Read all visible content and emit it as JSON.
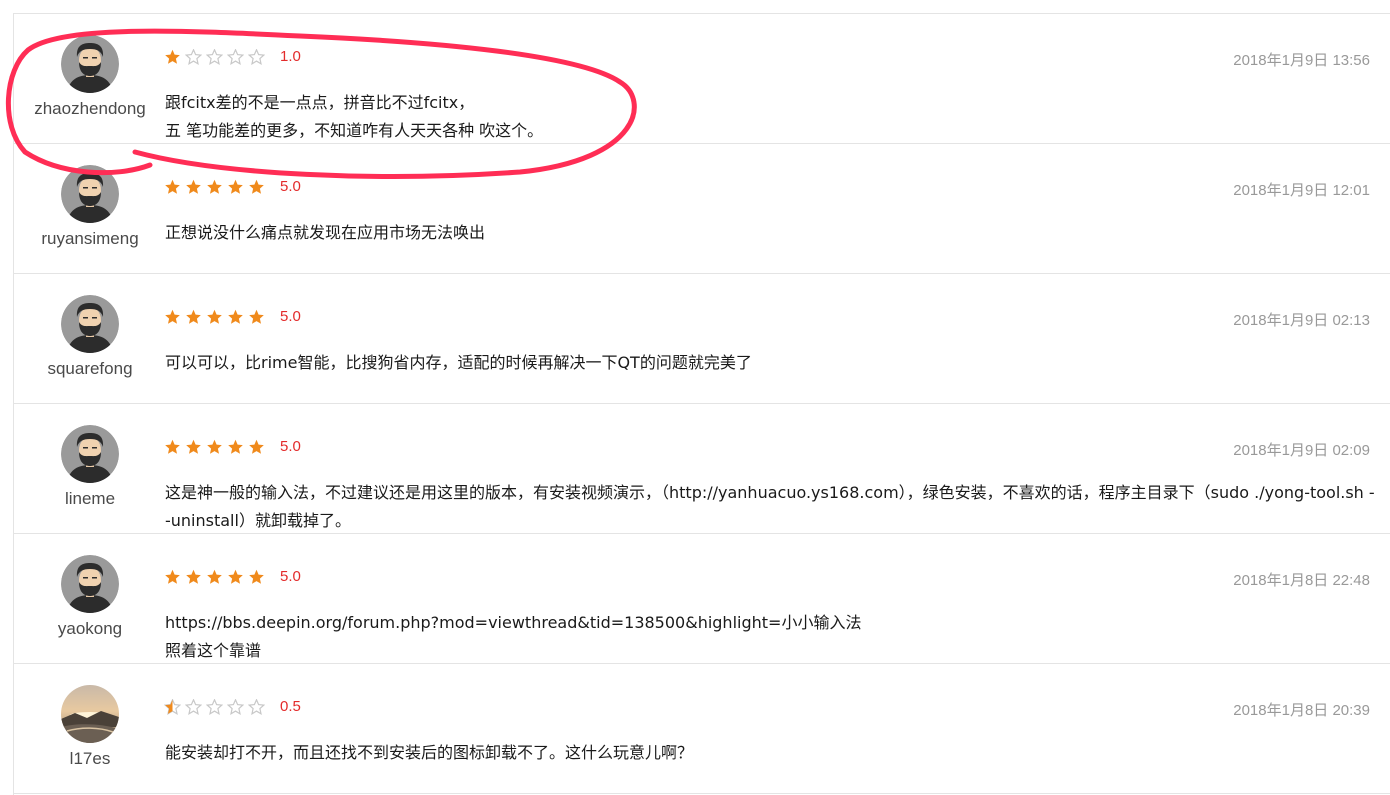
{
  "colors": {
    "star_filled": "#f08a1c",
    "star_empty": "#c8c8c8",
    "score": "#e32b2b",
    "date": "#999999",
    "annotation": "#ff2d55"
  },
  "reviews": [
    {
      "username": "zhaozhendong",
      "avatar": "bearded-man-avatar-icon",
      "rating": 1.0,
      "score_text": "1.0",
      "date": "2018年1月9日 13:56",
      "comment_lines": [
        "跟fcitx差的不是一点点，拼音比不过fcitx，",
        "五 笔功能差的更多，不知道咋有人天天各种 吹这个。"
      ]
    },
    {
      "username": "ruyansimeng",
      "avatar": "bearded-man-avatar-icon",
      "rating": 5.0,
      "score_text": "5.0",
      "date": "2018年1月9日 12:01",
      "comment_lines": [
        "正想说没什么痛点就发现在应用市场无法唤出"
      ]
    },
    {
      "username": "squarefong",
      "avatar": "bearded-man-avatar-icon",
      "rating": 5.0,
      "score_text": "5.0",
      "date": "2018年1月9日 02:13",
      "comment_lines": [
        "可以可以，比rime智能，比搜狗省内存，适配的时候再解决一下QT的问题就完美了"
      ]
    },
    {
      "username": "lineme",
      "avatar": "bearded-man-avatar-icon",
      "rating": 5.0,
      "score_text": "5.0",
      "date": "2018年1月9日 02:09",
      "comment_lines": [
        "这是神一般的输入法，不过建议还是用这里的版本，有安装视频演示，（http://yanhuacuo.ys168.com），绿色安装，不喜欢的话，程序主目录下（sudo ./yong-tool.sh --uninstall）就卸载掉了。"
      ]
    },
    {
      "username": "yaokong",
      "avatar": "bearded-man-avatar-icon",
      "rating": 5.0,
      "score_text": "5.0",
      "date": "2018年1月8日 22:48",
      "comment_lines": [
        "https://bbs.deepin.org/forum.php?mod=viewthread&tid=138500&highlight=小小输入法",
        "照着这个靠谱"
      ]
    },
    {
      "username": "l17es",
      "avatar": "landscape-photo-avatar-icon",
      "rating": 0.5,
      "score_text": "0.5",
      "date": "2018年1月8日 20:39",
      "comment_lines": [
        "能安装却打不开，而且还找不到安装后的图标卸载不了。这什么玩意儿啊？"
      ]
    }
  ]
}
